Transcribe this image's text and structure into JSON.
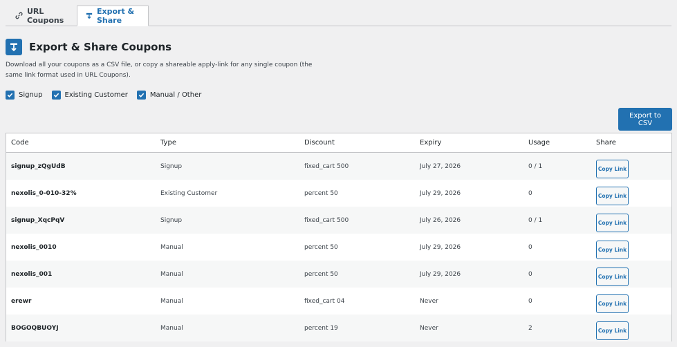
{
  "tabs": [
    {
      "label": "URL Coupons",
      "icon": "link-icon"
    },
    {
      "label": "Export & Share",
      "icon": "download-icon"
    }
  ],
  "page": {
    "title": "Export & Share Coupons",
    "description": "Download all your coupons as a CSV file, or copy a shareable apply-link for any single coupon (the same link format used in URL Coupons)."
  },
  "filters": [
    {
      "label": "Signup",
      "checked": true
    },
    {
      "label": "Existing Customer",
      "checked": true
    },
    {
      "label": "Manual / Other",
      "checked": true
    }
  ],
  "export_button": "Export to CSV",
  "colors": {
    "accent": "#2271b1",
    "stripe": "#f6f7f7"
  },
  "table": {
    "columns": [
      "Code",
      "Type",
      "Discount",
      "Expiry",
      "Usage",
      "Share"
    ],
    "rows": [
      {
        "code": "signup_zQgUdB",
        "type": "Signup",
        "discount": "fixed_cart 500",
        "expiry": "July 27, 2026",
        "usage": "0 / 1",
        "share": "Copy Link"
      },
      {
        "code": "nexolis_0-010-32%",
        "type": "Existing Customer",
        "discount": "percent 50",
        "expiry": "July 29, 2026",
        "usage": "0",
        "share": "Copy Link"
      },
      {
        "code": "signup_XqcPqV",
        "type": "Signup",
        "discount": "fixed_cart 500",
        "expiry": "July 26, 2026",
        "usage": "0 / 1",
        "share": "Copy Link"
      },
      {
        "code": "nexolis_0010",
        "type": "Manual",
        "discount": "percent 50",
        "expiry": "July 29, 2026",
        "usage": "0",
        "share": "Copy Link"
      },
      {
        "code": "nexolis_001",
        "type": "Manual",
        "discount": "percent 50",
        "expiry": "July 29, 2026",
        "usage": "0",
        "share": "Copy Link"
      },
      {
        "code": "erewr",
        "type": "Manual",
        "discount": "fixed_cart 04",
        "expiry": "Never",
        "usage": "0",
        "share": "Copy Link"
      },
      {
        "code": "BOGOQBUOYJ",
        "type": "Manual",
        "discount": "percent 19",
        "expiry": "Never",
        "usage": "2",
        "share": "Copy Link"
      }
    ]
  }
}
